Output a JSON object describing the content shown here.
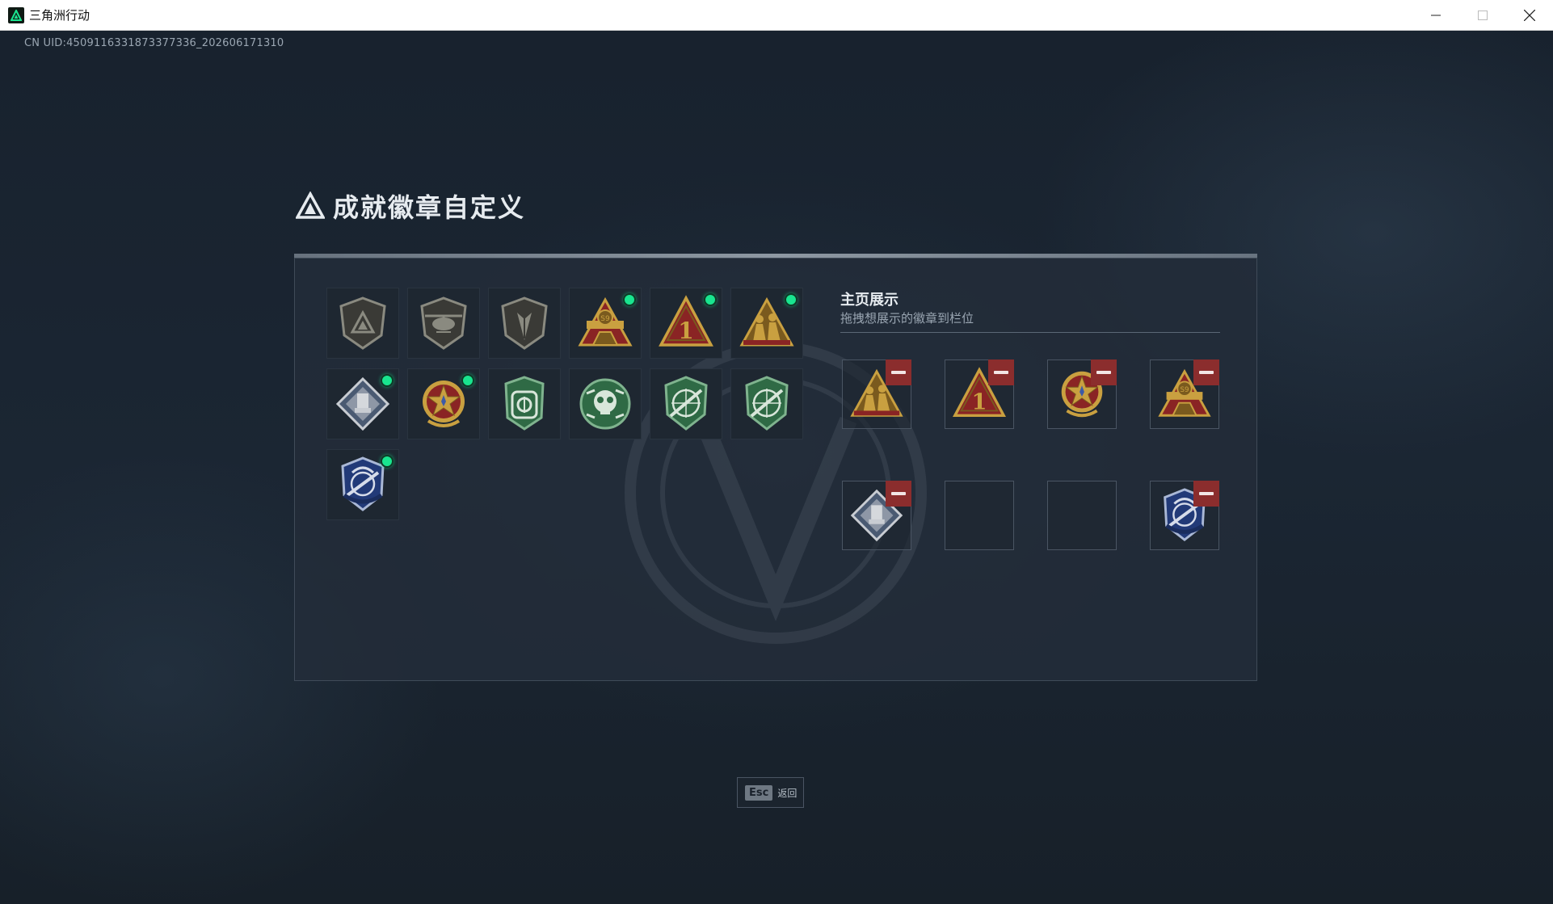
{
  "window": {
    "title": "三角洲行动",
    "controls": [
      "minimize",
      "maximize",
      "close"
    ]
  },
  "uid_text": "CN UID:4509116331873377336_202606171310",
  "panel": {
    "title": "成就徽章自定义"
  },
  "badges": [
    {
      "icon": "gray-delta-shield-badge-icon",
      "new": false
    },
    {
      "icon": "gray-helicopter-shield-badge-icon",
      "new": false
    },
    {
      "icon": "gray-arrow-shield-badge-icon",
      "new": false
    },
    {
      "icon": "gold-s9-triangle-badge-icon",
      "new": true
    },
    {
      "icon": "gold-number-one-triangle-badge-icon",
      "new": true
    },
    {
      "icon": "gold-soldiers-triangle-badge-icon",
      "new": true
    },
    {
      "icon": "silver-diamond-badge-icon",
      "new": true
    },
    {
      "icon": "gold-star-medal-badge-icon",
      "new": true
    },
    {
      "icon": "green-shield-badge-icon",
      "new": false
    },
    {
      "icon": "green-skull-badge-icon",
      "new": false
    },
    {
      "icon": "green-rifle-shield-badge-icon",
      "new": false
    },
    {
      "icon": "green-rifle-shield-badge-icon-2",
      "new": false
    },
    {
      "icon": "blue-rifle-shield-badge-icon",
      "new": true
    }
  ],
  "showcase": {
    "title": "主页展示",
    "subtitle": "拖拽想展示的徽章到栏位",
    "slots": [
      {
        "badge": "gold-soldiers-triangle-badge-icon"
      },
      {
        "badge": "gold-number-one-triangle-badge-icon"
      },
      {
        "badge": "gold-star-medal-badge-icon"
      },
      {
        "badge": "gold-s9-triangle-badge-icon"
      },
      {
        "badge": "silver-diamond-badge-icon"
      },
      {
        "badge": ""
      },
      {
        "badge": ""
      },
      {
        "badge": "blue-rifle-shield-badge-icon"
      }
    ]
  },
  "footer": {
    "esc_key": "Esc",
    "esc_label": "返回"
  },
  "colors": {
    "new_dot": "#19e58f",
    "remove_button": "#8b2d2d",
    "panel_bg": "#232d39"
  }
}
